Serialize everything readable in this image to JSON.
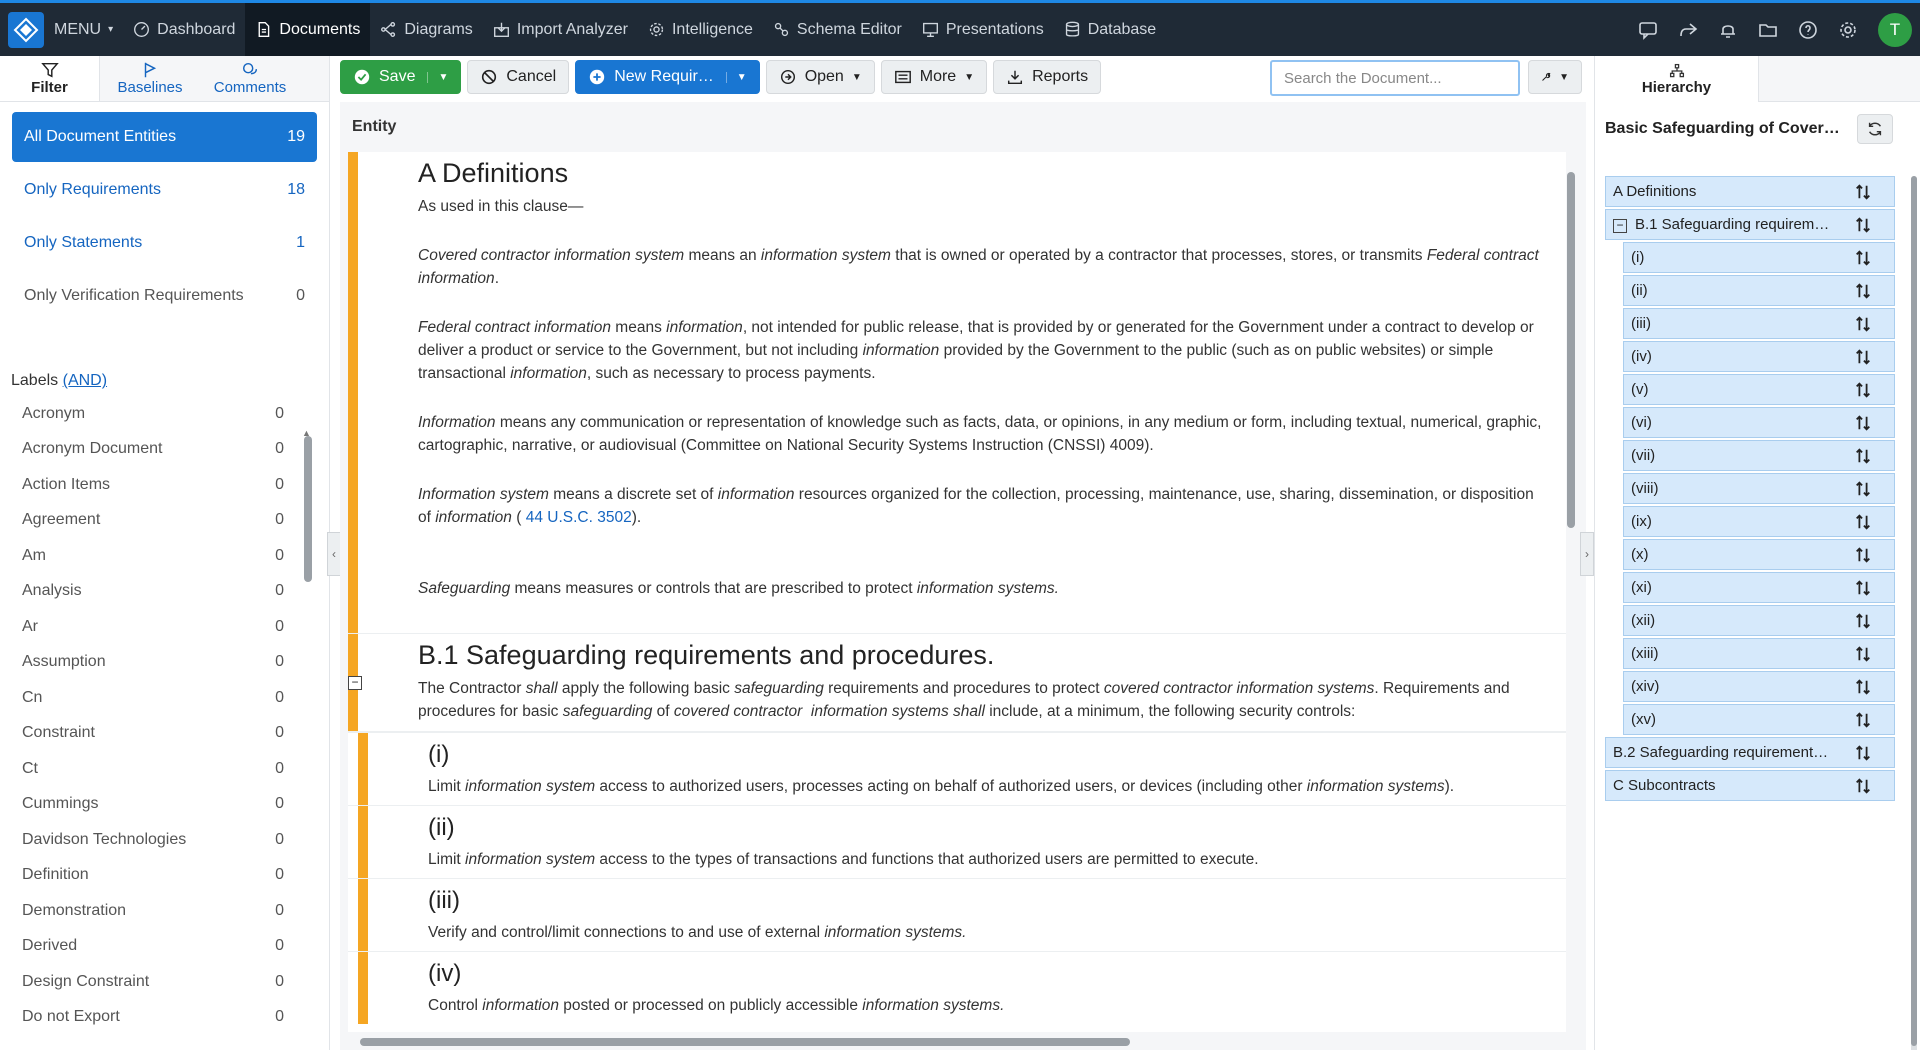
{
  "nav": {
    "menu": "MENU",
    "items": [
      {
        "label": "Dashboard",
        "icon": "gauge-icon"
      },
      {
        "label": "Documents",
        "icon": "document-icon",
        "active": true
      },
      {
        "label": "Diagrams",
        "icon": "diagram-icon"
      },
      {
        "label": "Import Analyzer",
        "icon": "import-icon"
      },
      {
        "label": "Intelligence",
        "icon": "gear-brain-icon"
      },
      {
        "label": "Schema Editor",
        "icon": "schema-icon"
      },
      {
        "label": "Presentations",
        "icon": "presentation-icon"
      },
      {
        "label": "Database",
        "icon": "database-icon"
      }
    ],
    "avatar": "T"
  },
  "left_tabs": {
    "filter": "Filter",
    "baselines": "Baselines",
    "comments": "Comments"
  },
  "entities": [
    {
      "label": "All Document Entities",
      "count": "19"
    },
    {
      "label": "Only Requirements",
      "count": "18"
    },
    {
      "label": "Only Statements",
      "count": "1"
    },
    {
      "label": "Only Verification Requirements",
      "count": "0"
    }
  ],
  "labels": {
    "title": "Labels",
    "mode": "(AND)",
    "items": [
      {
        "label": "Acronym",
        "count": "0"
      },
      {
        "label": "Acronym Document",
        "count": "0"
      },
      {
        "label": "Action Items",
        "count": "0"
      },
      {
        "label": "Agreement",
        "count": "0"
      },
      {
        "label": "Am",
        "count": "0"
      },
      {
        "label": "Analysis",
        "count": "0"
      },
      {
        "label": "Ar",
        "count": "0"
      },
      {
        "label": "Assumption",
        "count": "0"
      },
      {
        "label": "Cn",
        "count": "0"
      },
      {
        "label": "Constraint",
        "count": "0"
      },
      {
        "label": "Ct",
        "count": "0"
      },
      {
        "label": "Cummings",
        "count": "0"
      },
      {
        "label": "Davidson Technologies",
        "count": "0"
      },
      {
        "label": "Definition",
        "count": "0"
      },
      {
        "label": "Demonstration",
        "count": "0"
      },
      {
        "label": "Derived",
        "count": "0"
      },
      {
        "label": "Design Constraint",
        "count": "0"
      },
      {
        "label": "Do not Export",
        "count": "0"
      }
    ]
  },
  "toolbar": {
    "save": "Save",
    "cancel": "Cancel",
    "new_req": "New Requir…",
    "open": "Open",
    "more": "More",
    "reports": "Reports",
    "search_placeholder": "Search the Document..."
  },
  "doc": {
    "entity_header": "Entity",
    "a_title": "A Definitions",
    "a_intro": "As used in this clause—",
    "b1_title": "B.1 Safeguarding requirements and procedures.",
    "subs": [
      {
        "num": "(i)"
      },
      {
        "num": "(ii)"
      },
      {
        "num": "(iii)"
      },
      {
        "num": "(iv)"
      }
    ]
  },
  "right": {
    "tab": "Hierarchy",
    "title": "Basic Safeguarding of Covere…",
    "tree": [
      {
        "label": "A Definitions",
        "level": 0
      },
      {
        "label": "B.1 Safeguarding requirem…",
        "level": 0,
        "expanded": true
      },
      {
        "label": "(i)",
        "level": 1
      },
      {
        "label": "(ii)",
        "level": 1
      },
      {
        "label": "(iii)",
        "level": 1
      },
      {
        "label": "(iv)",
        "level": 1
      },
      {
        "label": "(v)",
        "level": 1
      },
      {
        "label": "(vi)",
        "level": 1
      },
      {
        "label": "(vii)",
        "level": 1
      },
      {
        "label": "(viii)",
        "level": 1
      },
      {
        "label": "(ix)",
        "level": 1
      },
      {
        "label": "(x)",
        "level": 1
      },
      {
        "label": "(xi)",
        "level": 1
      },
      {
        "label": "(xii)",
        "level": 1
      },
      {
        "label": "(xiii)",
        "level": 1
      },
      {
        "label": "(xiv)",
        "level": 1
      },
      {
        "label": "(xv)",
        "level": 1
      },
      {
        "label": "B.2 Safeguarding requirement…",
        "level": 0
      },
      {
        "label": "C Subcontracts",
        "level": 0
      }
    ]
  },
  "colors": {
    "accent": "#1976d2",
    "save": "#2e9e45",
    "bar": "#f5a623",
    "node": "#d6e9fb"
  }
}
